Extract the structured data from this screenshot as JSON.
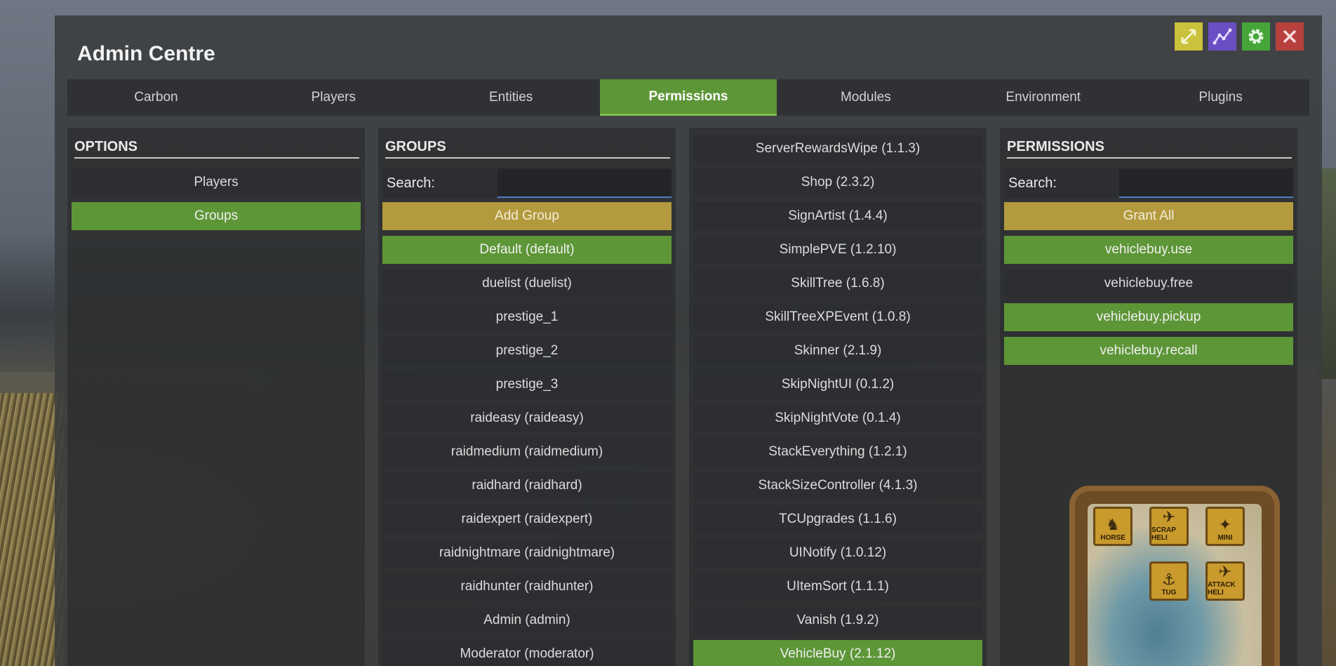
{
  "window": {
    "title": "Admin Centre"
  },
  "top_buttons": [
    {
      "name": "fullscreen-icon",
      "color": "#c9c23a"
    },
    {
      "name": "chart-line-icon",
      "color": "#6a4fc4"
    },
    {
      "name": "gear-icon",
      "color": "#46a63a"
    },
    {
      "name": "close-icon",
      "color": "#b8403d"
    }
  ],
  "tabs": [
    {
      "label": "Carbon",
      "active": false
    },
    {
      "label": "Players",
      "active": false
    },
    {
      "label": "Entities",
      "active": false
    },
    {
      "label": "Permissions",
      "active": true
    },
    {
      "label": "Modules",
      "active": false
    },
    {
      "label": "Environment",
      "active": false
    },
    {
      "label": "Plugins",
      "active": false
    }
  ],
  "options": {
    "header": "OPTIONS",
    "items": [
      {
        "label": "Players",
        "state": "normal"
      },
      {
        "label": "Groups",
        "state": "selected"
      }
    ]
  },
  "groups": {
    "header": "GROUPS",
    "search_label": "Search:",
    "search_value": "",
    "add_button": "Add Group",
    "items": [
      {
        "label": "Default  (default)",
        "state": "selected"
      },
      {
        "label": "duelist (duelist)",
        "state": "normal"
      },
      {
        "label": "prestige_1",
        "state": "normal"
      },
      {
        "label": "prestige_2",
        "state": "normal"
      },
      {
        "label": "prestige_3",
        "state": "normal"
      },
      {
        "label": "raideasy (raideasy)",
        "state": "normal"
      },
      {
        "label": "raidmedium (raidmedium)",
        "state": "normal"
      },
      {
        "label": "raidhard (raidhard)",
        "state": "normal"
      },
      {
        "label": "raidexpert (raidexpert)",
        "state": "normal"
      },
      {
        "label": "raidnightmare (raidnightmare)",
        "state": "normal"
      },
      {
        "label": "raidhunter (raidhunter)",
        "state": "normal"
      },
      {
        "label": "Admin  (admin)",
        "state": "normal"
      },
      {
        "label": "Moderator  (moderator)",
        "state": "normal"
      }
    ]
  },
  "plugins": {
    "items": [
      {
        "label": "ServerRewardsWipe (1.1.3)",
        "state": "normal"
      },
      {
        "label": "Shop (2.3.2)",
        "state": "normal"
      },
      {
        "label": "SignArtist (1.4.4)",
        "state": "normal"
      },
      {
        "label": "SimplePVE (1.2.10)",
        "state": "normal"
      },
      {
        "label": "SkillTree (1.6.8)",
        "state": "normal"
      },
      {
        "label": "SkillTreeXPEvent (1.0.8)",
        "state": "normal"
      },
      {
        "label": "Skinner (2.1.9)",
        "state": "normal"
      },
      {
        "label": "SkipNightUI (0.1.2)",
        "state": "normal"
      },
      {
        "label": "SkipNightVote (0.1.4)",
        "state": "normal"
      },
      {
        "label": "StackEverything (1.2.1)",
        "state": "normal"
      },
      {
        "label": "StackSizeController (4.1.3)",
        "state": "normal"
      },
      {
        "label": "TCUpgrades (1.1.6)",
        "state": "normal"
      },
      {
        "label": "UINotify (1.0.12)",
        "state": "normal"
      },
      {
        "label": "UItemSort (1.1.1)",
        "state": "normal"
      },
      {
        "label": "Vanish (1.9.2)",
        "state": "normal"
      },
      {
        "label": "VehicleBuy (2.1.12)",
        "state": "selected"
      }
    ]
  },
  "permissions": {
    "header": "PERMISSIONS",
    "search_label": "Search:",
    "search_value": "",
    "grant_all_button": "Grant All",
    "items": [
      {
        "label": "vehiclebuy.use",
        "state": "granted"
      },
      {
        "label": "vehiclebuy.free",
        "state": "normal"
      },
      {
        "label": "vehiclebuy.pickup",
        "state": "granted"
      },
      {
        "label": "vehiclebuy.recall",
        "state": "granted"
      }
    ]
  },
  "vehicle_map": {
    "icons": [
      {
        "label": "HORSE",
        "icon": "horse-icon"
      },
      {
        "label": "SCRAP HELI",
        "icon": "scrap-heli-icon"
      },
      {
        "label": "MINI",
        "icon": "minicopter-icon"
      },
      {
        "label": "TUG",
        "icon": "tugboat-icon"
      },
      {
        "label": "ATTACK HELI",
        "icon": "attack-heli-icon"
      }
    ]
  }
}
